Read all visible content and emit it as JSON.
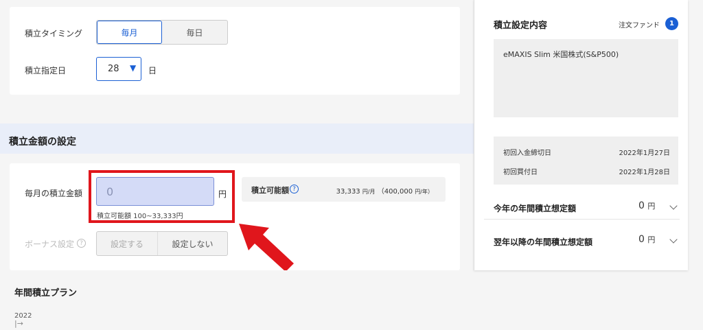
{
  "timing": {
    "label": "積立タイミング",
    "options": [
      "毎月",
      "毎日"
    ],
    "selected": "毎月"
  },
  "day": {
    "label": "積立指定日",
    "value": "28",
    "unit": "日"
  },
  "amount_section": {
    "title": "積立金額の設定",
    "monthly_label": "毎月の積立金額",
    "input_value": "0",
    "unit": "円",
    "hint": "積立可能額 100~33,333円",
    "available_label": "積立可能額",
    "available_value": "33,333",
    "available_per_month": "円/月",
    "available_year": "（400,000",
    "available_year_unit": "円/年）",
    "bonus_label": "ボーナス設定",
    "bonus_options": [
      "設定する",
      "設定しない"
    ]
  },
  "plan": {
    "title": "年間積立プラン",
    "year": "2022",
    "arrow": "|→"
  },
  "summary": {
    "title": "積立設定内容",
    "order_fund_label": "注文ファンド",
    "order_fund_count": "1",
    "fund_name": "eMAXIS Slim 米国株式(S&P500)",
    "first_deposit_label": "初回入金締切日",
    "first_deposit_date": "2022年1月27日",
    "first_buy_label": "初回買付日",
    "first_buy_date": "2022年1月28日",
    "this_year_label": "今年の年間積立想定額",
    "this_year_value": "0",
    "next_year_label": "翌年以降の年間積立想定額",
    "next_year_value": "0",
    "yen": "円"
  },
  "colors": {
    "accent": "#1a5fd4",
    "highlight": "#e0161c",
    "section_band": "#e9eef9",
    "input_fill": "#d4dbf7"
  },
  "icons": [
    "help-icon",
    "dropdown-triangle-icon",
    "chevron-down-icon",
    "arrow-icon"
  ]
}
